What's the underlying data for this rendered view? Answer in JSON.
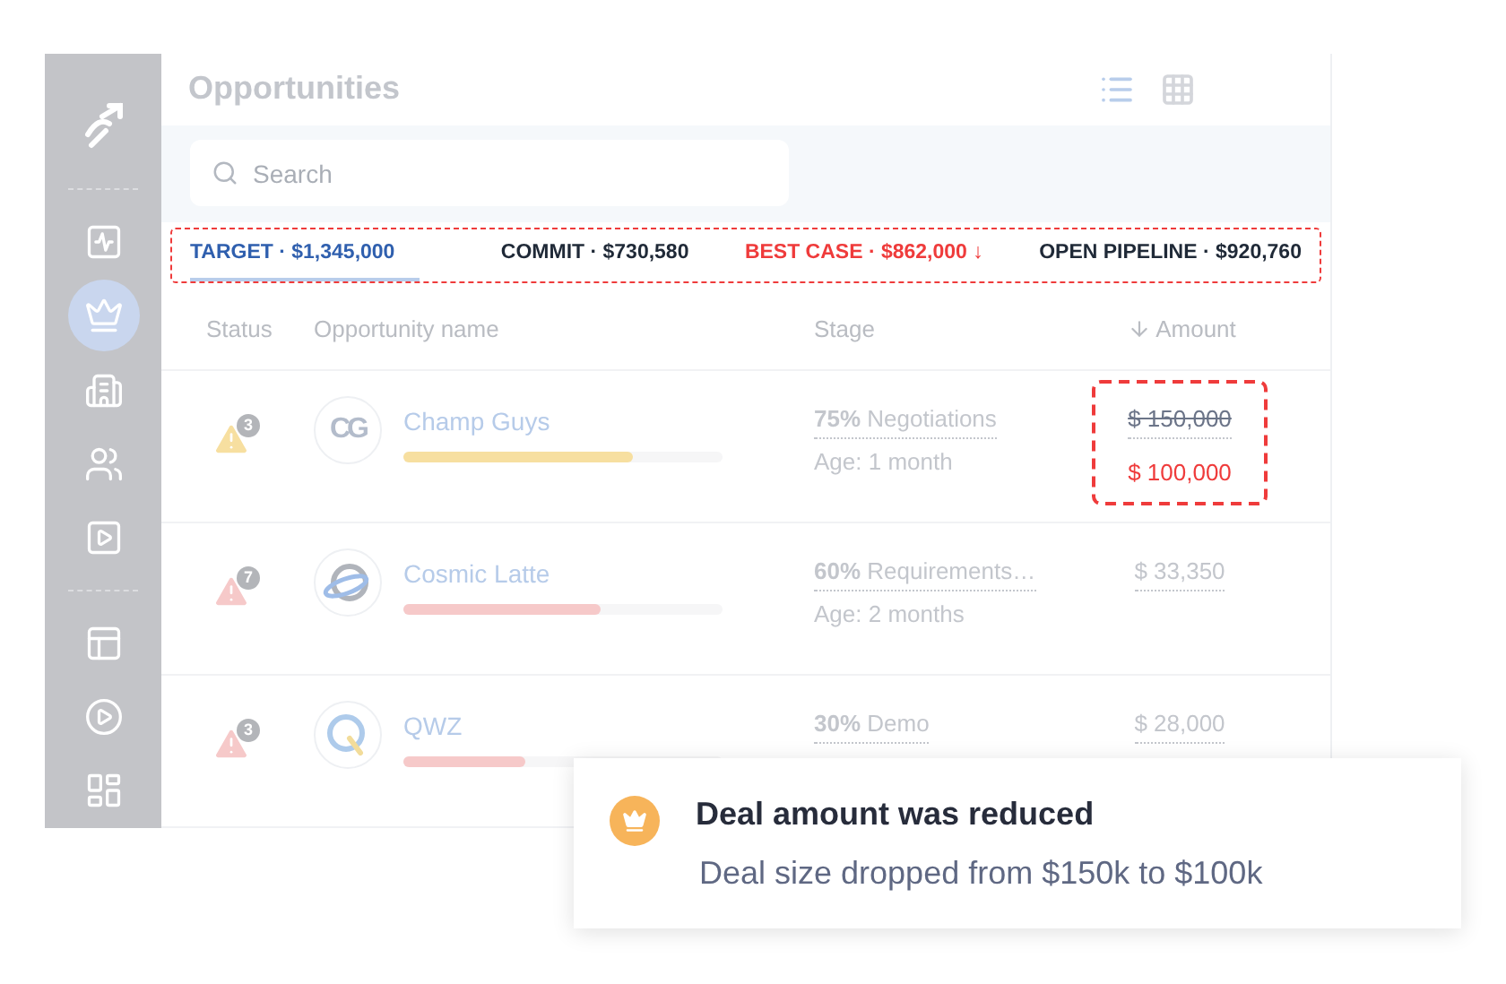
{
  "sidebar": {
    "groups": [
      [
        {
          "kind": "logo"
        }
      ],
      [
        {
          "kind": "activity",
          "selected": false
        },
        {
          "kind": "crown",
          "selected": true
        },
        {
          "kind": "building",
          "selected": false
        },
        {
          "kind": "people",
          "selected": false
        },
        {
          "kind": "play",
          "selected": false
        }
      ],
      [
        {
          "kind": "layout",
          "selected": false
        },
        {
          "kind": "play-circle",
          "selected": false
        },
        {
          "kind": "grid",
          "selected": false
        }
      ]
    ]
  },
  "header": {
    "title": "Opportunities",
    "views": [
      {
        "kind": "list",
        "selected": true
      },
      {
        "kind": "grid",
        "selected": false
      }
    ]
  },
  "search": {
    "placeholder": "Search"
  },
  "metrics": {
    "highlighted": true,
    "items": [
      {
        "label": "TARGET · $1,345,000",
        "color": "#2f5fae",
        "selected": true
      },
      {
        "label": "COMMIT · $730,580",
        "color": "#1f2937",
        "selected": false
      },
      {
        "label": "BEST CASE · $862,000 ↓",
        "color": "#ef3b3b",
        "selected": false
      },
      {
        "label": "OPEN PIPELINE · $920,760",
        "color": "#1f2937",
        "selected": false
      }
    ]
  },
  "table": {
    "columns": [
      {
        "label": "Status",
        "sorted": false
      },
      {
        "label": "Opportunity name",
        "sorted": false
      },
      {
        "label": "Stage",
        "sorted": false
      },
      {
        "label": "Amount",
        "sorted": true
      }
    ],
    "rows": [
      {
        "alert_count": "3",
        "color": "#f7dfa0",
        "kind": "letters",
        "logo_text": "CG",
        "name": "Champ Guys",
        "level": 0.72,
        "stage": "**75%** Negotiations",
        "age": "Age: 1 month",
        "amount": "$ 150,000",
        "struck": true,
        "new_amount": "$ 100,000",
        "highlighted": true
      },
      {
        "alert_count": "7",
        "color": "#f6c9c9",
        "kind": "planet",
        "name": "Cosmic Latte",
        "level": 0.62,
        "stage": "**60%** Requirements…",
        "age": "Age: 2 months",
        "amount": "$ 33,350",
        "struck": false,
        "highlighted": false
      },
      {
        "alert_count": "3",
        "color": "#f6c9c9",
        "kind": "ring",
        "name": "QWZ",
        "level": 0.38,
        "stage": "**30%** Demo",
        "amount": "$ 28,000",
        "struck": false,
        "highlighted": false
      }
    ]
  },
  "toast": {
    "title": "Deal amount was reduced",
    "message": "Deal size dropped from $150k to $100k"
  }
}
